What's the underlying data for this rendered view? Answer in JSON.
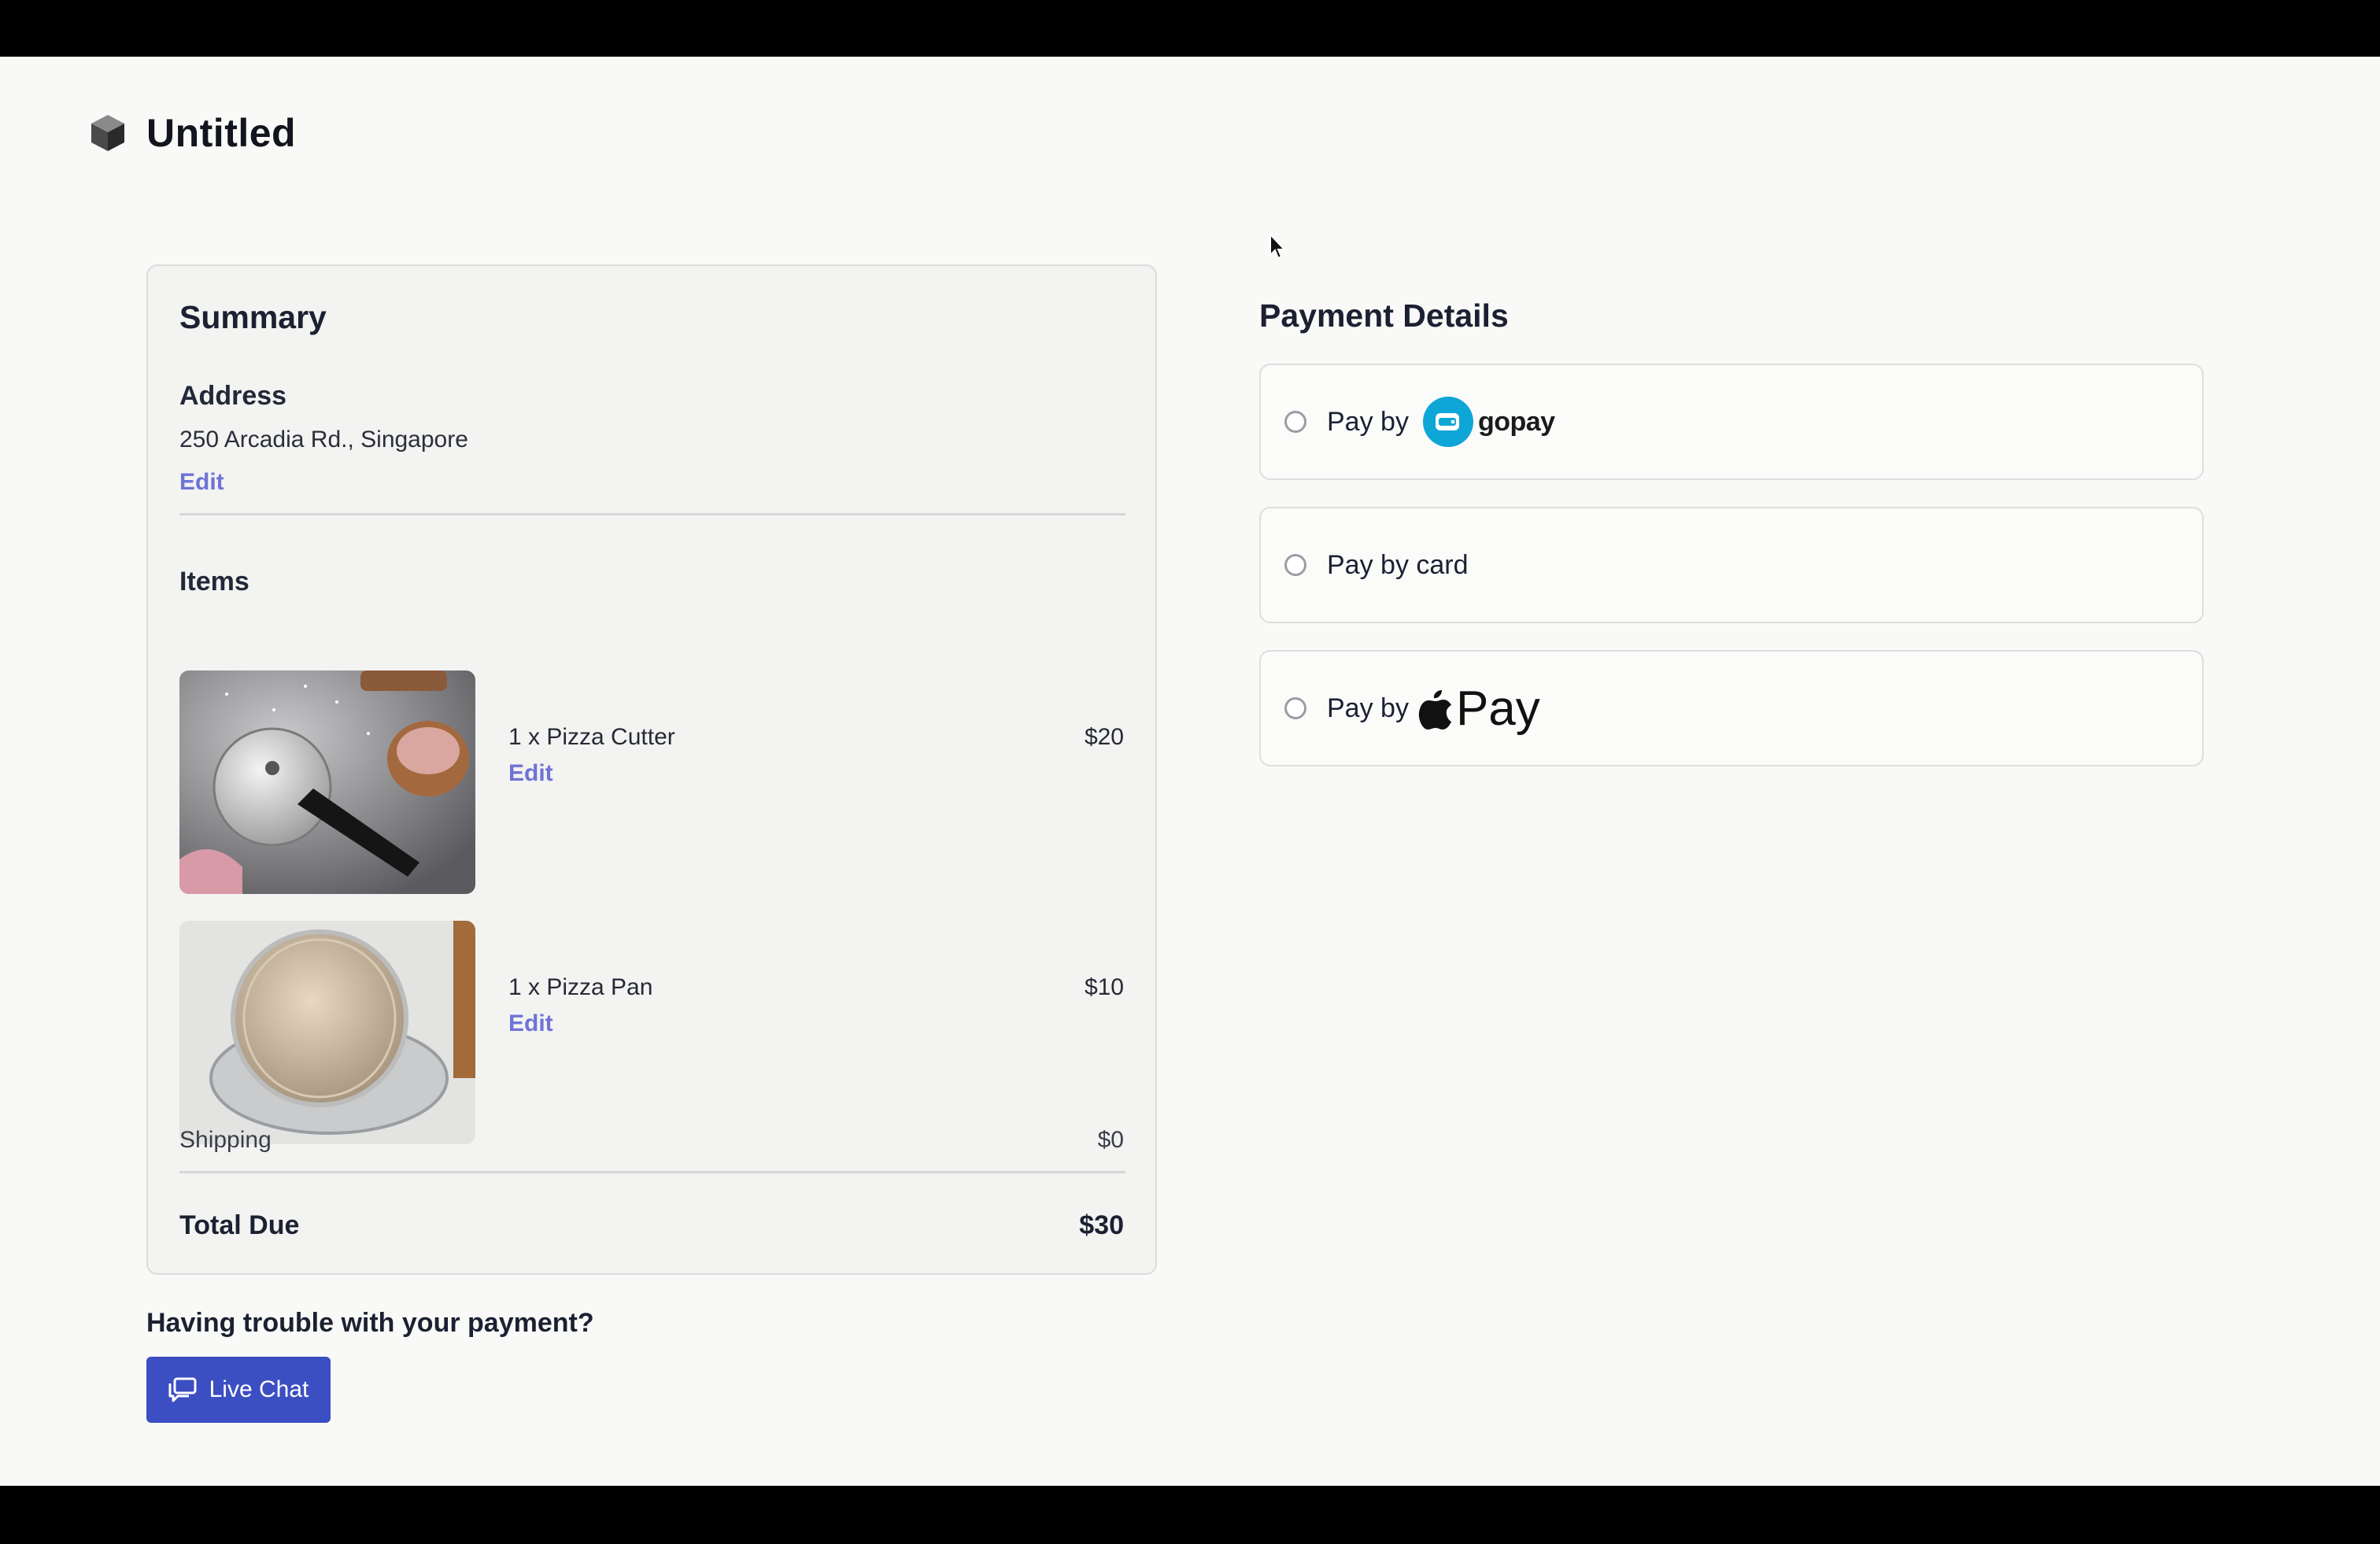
{
  "app": {
    "title": "Untitled"
  },
  "summary": {
    "heading": "Summary",
    "address_label": "Address",
    "address": "250 Arcadia Rd., Singapore",
    "edit_label": "Edit",
    "items_label": "Items",
    "items": [
      {
        "name": "1 x Pizza Cutter",
        "price": "$20",
        "edit": "Edit"
      },
      {
        "name": "1 x Pizza Pan",
        "price": "$10",
        "edit": "Edit"
      }
    ],
    "shipping_label": "Shipping",
    "shipping_value": "$0",
    "total_label": "Total Due",
    "total_value": "$30"
  },
  "help": {
    "question": "Having trouble with your payment?",
    "chat_label": "Live Chat"
  },
  "payment": {
    "heading": "Payment Details",
    "options": [
      {
        "prefix": "Pay by",
        "brand": "gopay"
      },
      {
        "prefix": "Pay by card"
      },
      {
        "prefix": "Pay by",
        "brand": "Pay"
      }
    ]
  },
  "colors": {
    "accent": "#3b4ec2",
    "link": "#6f73d6",
    "gopay": "#0ea5d7"
  },
  "icons": [
    "cube-logo-icon",
    "chat-bubbles-icon",
    "wallet-icon",
    "apple-icon",
    "mouse-cursor-icon"
  ]
}
